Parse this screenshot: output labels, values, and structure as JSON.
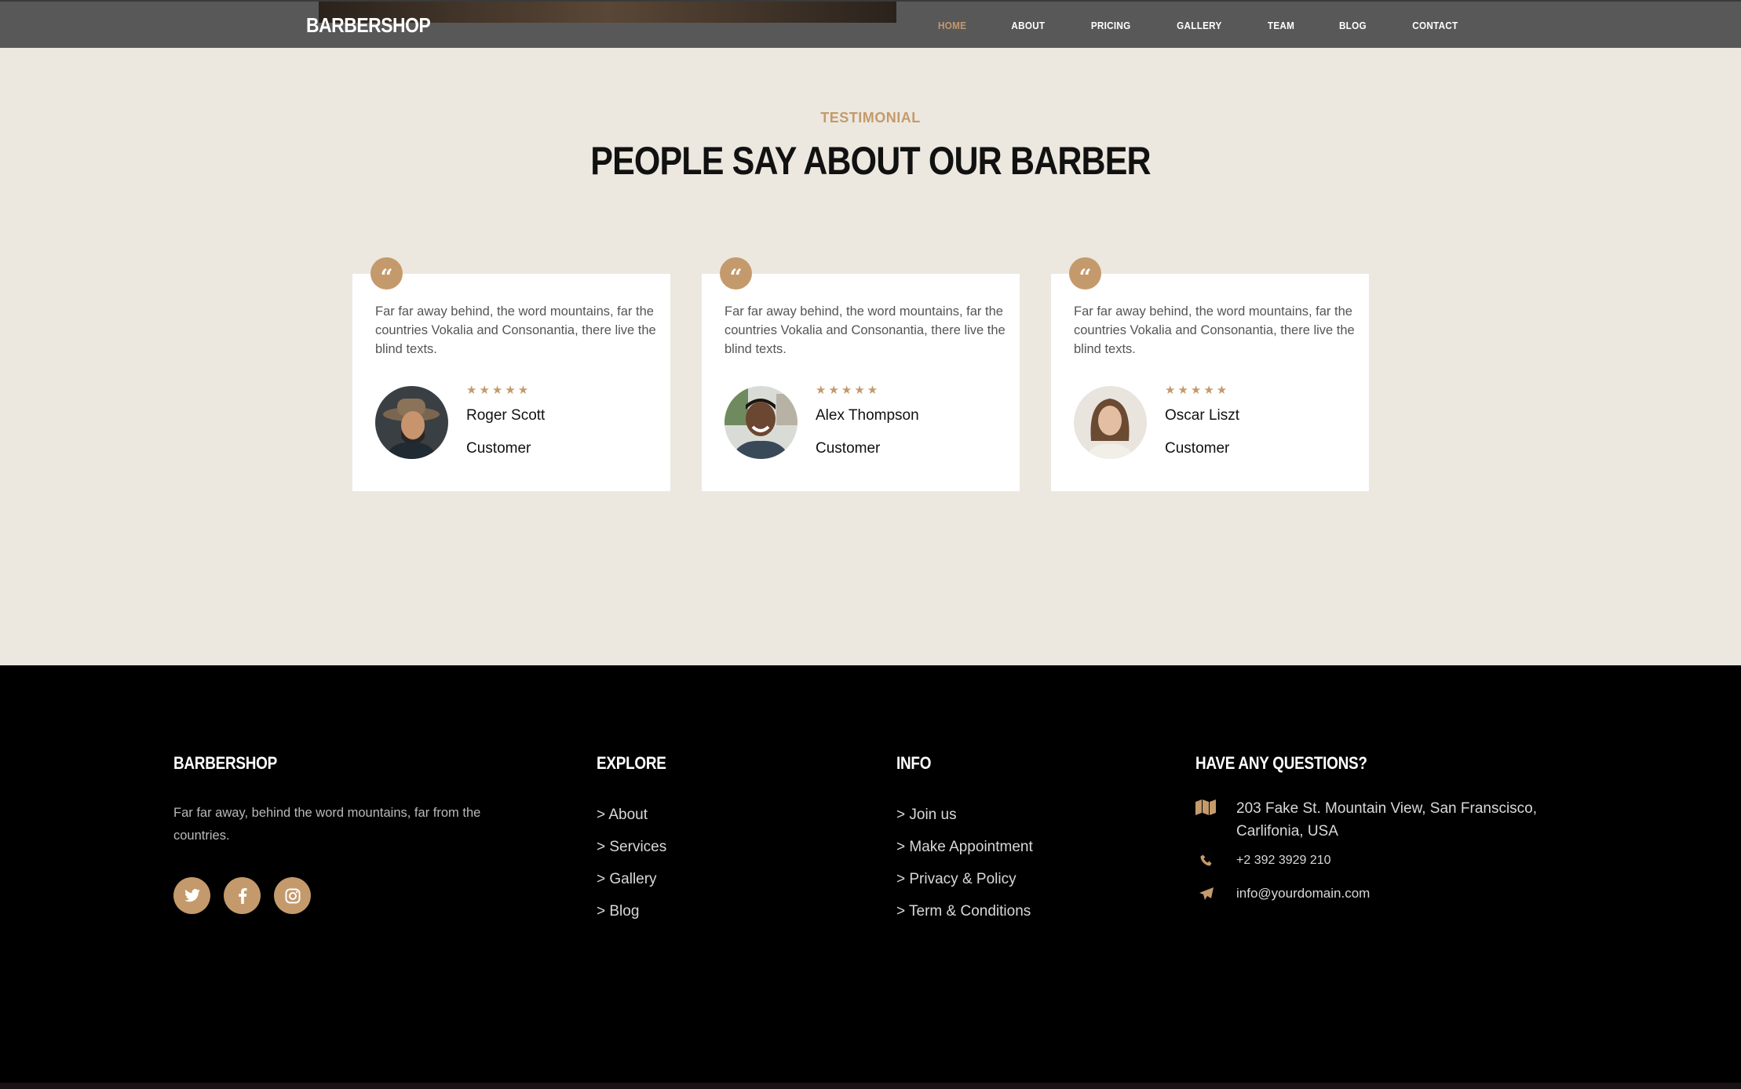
{
  "nav": {
    "brand": "BARBERSHOP",
    "links": [
      "HOME",
      "ABOUT",
      "PRICING",
      "GALLERY",
      "TEAM",
      "BLOG",
      "CONTACT"
    ],
    "active": "HOME"
  },
  "testimonial": {
    "eyebrow": "TESTIMONIAL",
    "title": "PEOPLE SAY ABOUT OUR BARBER",
    "cards": [
      {
        "text": "Far far away behind, the word mountains, far the countries Vokalia and Consonantia, there live the blind texts.",
        "stars": "★★★★★",
        "name": "Roger Scott",
        "role": "Customer"
      },
      {
        "text": "Far far away behind, the word mountains, far the countries Vokalia and Consonantia, there live the blind texts.",
        "stars": "★★★★★",
        "name": "Alex Thompson",
        "role": "Customer"
      },
      {
        "text": "Far far away behind, the word mountains, far the countries Vokalia and Consonantia, there live the blind texts.",
        "stars": "★★★★★",
        "name": "Oscar Liszt",
        "role": "Customer"
      }
    ]
  },
  "footer": {
    "brand": "BARBERSHOP",
    "description": "Far far away, behind the word mountains, far from the countries.",
    "explore": {
      "title": "EXPLORE",
      "items": [
        "About",
        "Services",
        "Gallery",
        "Blog"
      ]
    },
    "info": {
      "title": "INFO",
      "items": [
        "Join us",
        "Make Appointment",
        "Privacy & Policy",
        "Term & Conditions"
      ]
    },
    "contact": {
      "title": "HAVE ANY QUESTIONS?",
      "address": "203 Fake St. Mountain View, San Franscisco, Carlifonia, USA",
      "phone": "+2 392 3929 210",
      "email": "info@yourdomain.com"
    }
  },
  "colors": {
    "accent": "#c49a6c",
    "nav_bg": "#585858",
    "section_bg": "#ece8e0",
    "footer_bg": "#000000"
  }
}
